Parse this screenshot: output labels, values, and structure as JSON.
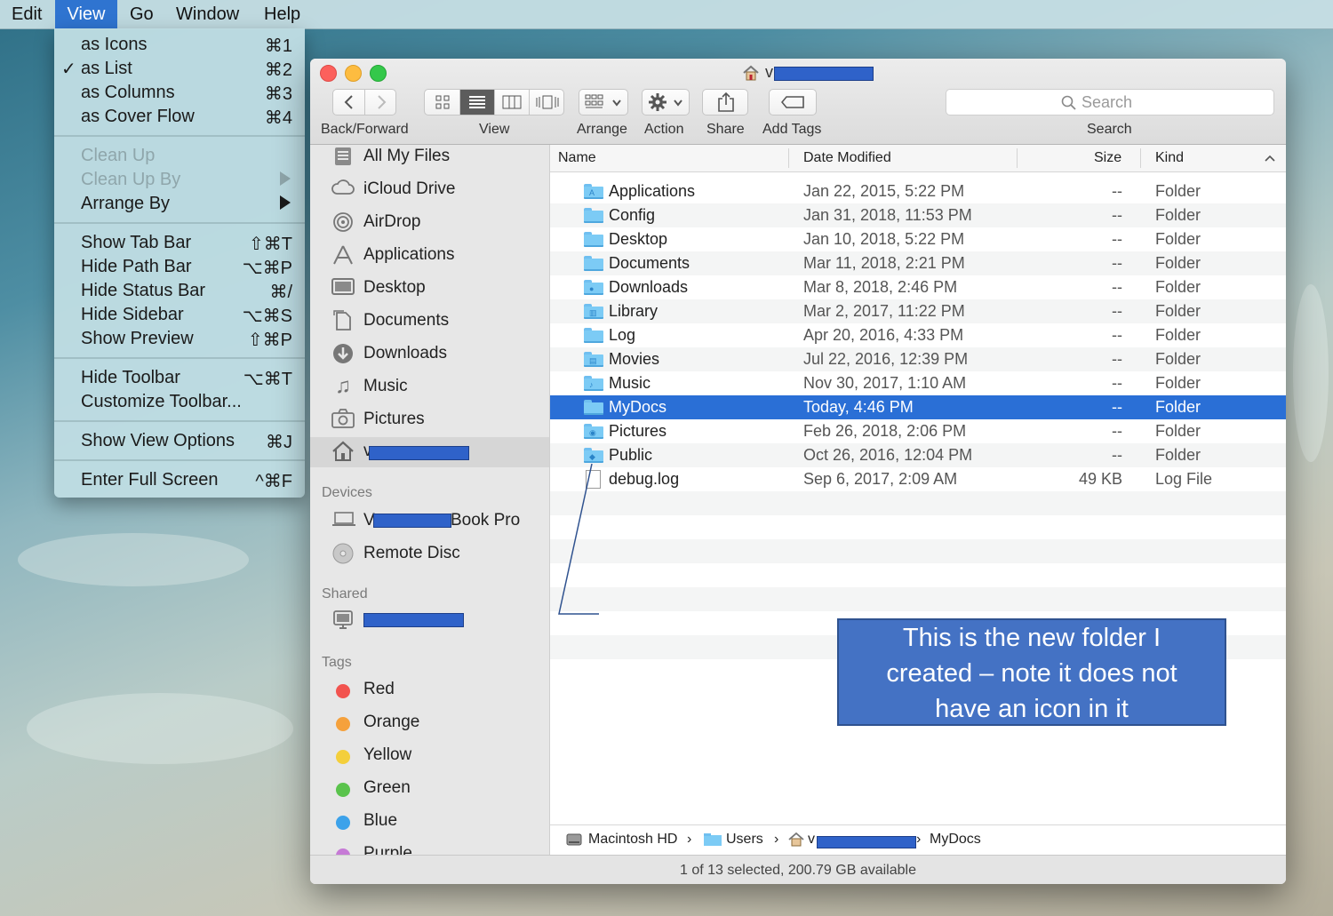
{
  "menubar": {
    "items": [
      {
        "label": "Edit"
      },
      {
        "label": "View"
      },
      {
        "label": "Go"
      },
      {
        "label": "Window"
      },
      {
        "label": "Help"
      }
    ]
  },
  "view_menu": {
    "items": [
      {
        "label": "as Icons",
        "shortcut": "⌘1"
      },
      {
        "label": "as List",
        "shortcut": "⌘2",
        "check": "✓"
      },
      {
        "label": "as Columns",
        "shortcut": "⌘3"
      },
      {
        "label": "as Cover Flow",
        "shortcut": "⌘4"
      },
      {
        "label": "Clean Up"
      },
      {
        "label": "Clean Up By"
      },
      {
        "label": "Arrange By"
      },
      {
        "label": "Show Tab Bar",
        "shortcut": "⇧⌘T"
      },
      {
        "label": "Hide Path Bar",
        "shortcut": "⌥⌘P"
      },
      {
        "label": "Hide Status Bar",
        "shortcut": "⌘/"
      },
      {
        "label": "Hide Sidebar",
        "shortcut": "⌥⌘S"
      },
      {
        "label": "Show Preview",
        "shortcut": "⇧⌘P"
      },
      {
        "label": "Hide Toolbar",
        "shortcut": "⌥⌘T"
      },
      {
        "label": "Customize Toolbar..."
      },
      {
        "label": "Show View Options",
        "shortcut": "⌘J"
      },
      {
        "label": "Enter Full Screen",
        "shortcut": "^⌘F"
      }
    ]
  },
  "window": {
    "title_prefix": "v",
    "toolbar": {
      "back_forward_label": "Back/Forward",
      "view_label": "View",
      "arrange_label": "Arrange",
      "action_label": "Action",
      "share_label": "Share",
      "add_tags_label": "Add Tags",
      "search_label": "Search",
      "search_placeholder": "Search"
    },
    "sidebar": {
      "favorites": [
        {
          "label": "All My Files",
          "icon": "all-files-icon"
        },
        {
          "label": "iCloud Drive",
          "icon": "cloud-icon"
        },
        {
          "label": "AirDrop",
          "icon": "airdrop-icon"
        },
        {
          "label": "Applications",
          "icon": "applications-icon"
        },
        {
          "label": "Desktop",
          "icon": "desktop-icon"
        },
        {
          "label": "Documents",
          "icon": "documents-icon"
        },
        {
          "label": "Downloads",
          "icon": "downloads-icon"
        },
        {
          "label": "Music",
          "icon": "music-icon"
        },
        {
          "label": "Pictures",
          "icon": "camera-icon"
        },
        {
          "label": "v",
          "icon": "home-icon"
        }
      ],
      "devices_heading": "Devices",
      "devices": [
        {
          "label_prefix": "V",
          "label_suffix": "Book Pro",
          "icon": "laptop-icon"
        },
        {
          "label": "Remote Disc",
          "icon": "disc-icon"
        }
      ],
      "shared_heading": "Shared",
      "tags_heading": "Tags",
      "tags": [
        {
          "label": "Red",
          "color": "#f2534f"
        },
        {
          "label": "Orange",
          "color": "#f5a13c"
        },
        {
          "label": "Yellow",
          "color": "#f4cf3b"
        },
        {
          "label": "Green",
          "color": "#5ac34c"
        },
        {
          "label": "Blue",
          "color": "#3ca2ea"
        },
        {
          "label": "Purple",
          "color": "#c67ad6"
        }
      ]
    },
    "list": {
      "columns": {
        "name": "Name",
        "date": "Date Modified",
        "size": "Size",
        "kind": "Kind"
      },
      "rows": [
        {
          "name": "Applications",
          "date": "Jan 22, 2015, 5:22 PM",
          "size": "--",
          "kind": "Folder",
          "icon": "A"
        },
        {
          "name": "Config",
          "date": "Jan 31, 2018, 11:53 PM",
          "size": "--",
          "kind": "Folder",
          "icon": ""
        },
        {
          "name": "Desktop",
          "date": "Jan 10, 2018, 5:22 PM",
          "size": "--",
          "kind": "Folder",
          "icon": ""
        },
        {
          "name": "Documents",
          "date": "Mar 11, 2018, 2:21 PM",
          "size": "--",
          "kind": "Folder",
          "icon": ""
        },
        {
          "name": "Downloads",
          "date": "Mar 8, 2018, 2:46 PM",
          "size": "--",
          "kind": "Folder",
          "icon": "●"
        },
        {
          "name": "Library",
          "date": "Mar 2, 2017, 11:22 PM",
          "size": "--",
          "kind": "Folder",
          "icon": "▥"
        },
        {
          "name": "Log",
          "date": "Apr 20, 2016, 4:33 PM",
          "size": "--",
          "kind": "Folder",
          "icon": ""
        },
        {
          "name": "Movies",
          "date": "Jul 22, 2016, 12:39 PM",
          "size": "--",
          "kind": "Folder",
          "icon": "▤"
        },
        {
          "name": "Music",
          "date": "Nov 30, 2017, 1:10 AM",
          "size": "--",
          "kind": "Folder",
          "icon": "♪"
        },
        {
          "name": "MyDocs",
          "date": "Today, 4:46 PM",
          "size": "--",
          "kind": "Folder",
          "icon": "",
          "selected": true
        },
        {
          "name": "Pictures",
          "date": "Feb 26, 2018, 2:06 PM",
          "size": "--",
          "kind": "Folder",
          "icon": "◉"
        },
        {
          "name": "Public",
          "date": "Oct 26, 2016, 12:04 PM",
          "size": "--",
          "kind": "Folder",
          "icon": "◆"
        },
        {
          "name": "debug.log",
          "date": "Sep 6, 2017, 2:09 AM",
          "size": "49 KB",
          "kind": "Log File",
          "icon": "doc"
        }
      ]
    },
    "callout": {
      "line1": "This is the new folder I",
      "line2": "created – note it does not",
      "line3": "have an icon in it"
    },
    "pathbar": {
      "disk": "Macintosh HD",
      "users": "Users",
      "user_prefix": "v",
      "current": "MyDocs"
    },
    "status": "1 of 13 selected, 200.79 GB available"
  }
}
